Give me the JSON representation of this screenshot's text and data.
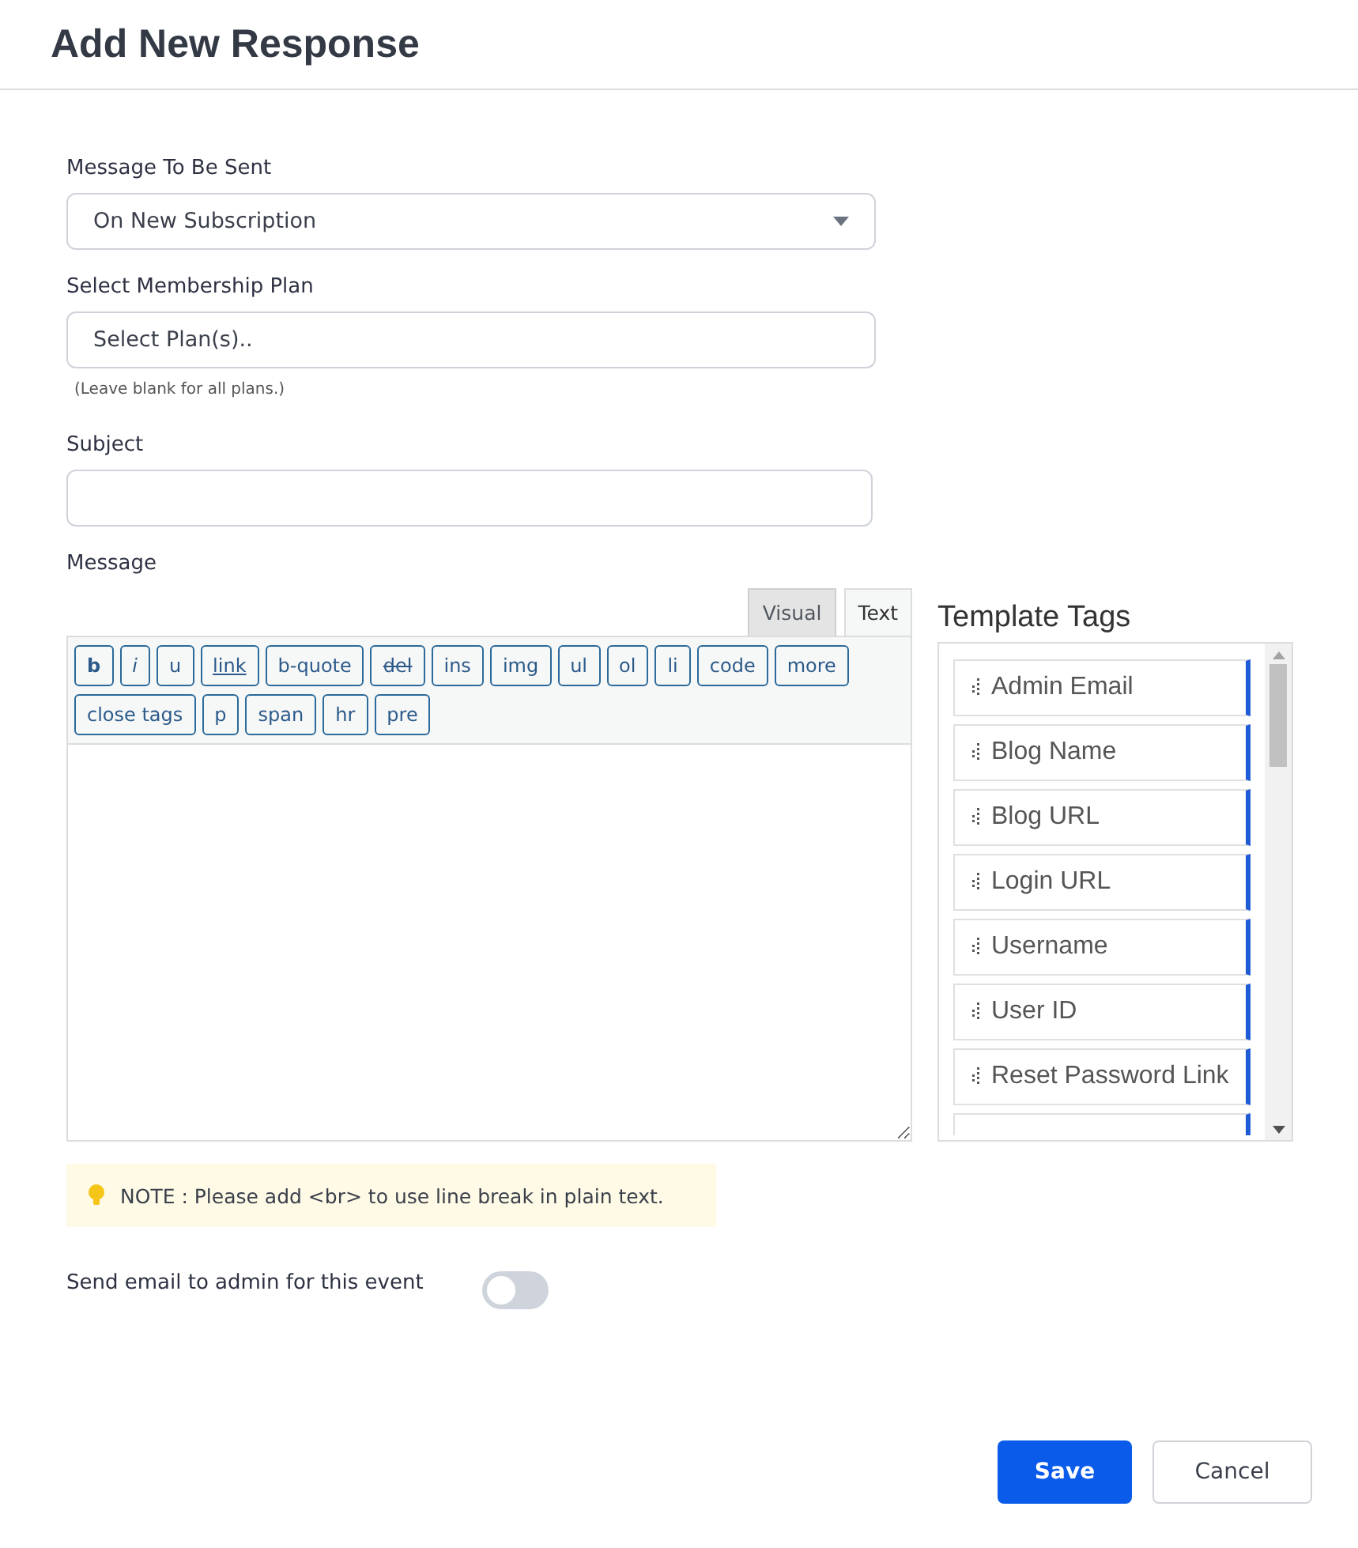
{
  "header": {
    "title": "Add New Response"
  },
  "message_to_be_sent": {
    "label": "Message To Be Sent",
    "value": "On New Subscription"
  },
  "membership_plan": {
    "label": "Select Membership Plan",
    "placeholder": "Select Plan(s)..",
    "hint": "(Leave blank for all plans.)"
  },
  "subject": {
    "label": "Subject"
  },
  "message": {
    "label": "Message",
    "tabs": [
      {
        "label": "Visual",
        "selected": false
      },
      {
        "label": "Text",
        "selected": true
      }
    ],
    "quicktags": [
      {
        "label": "b",
        "kind": "bold"
      },
      {
        "label": "i",
        "kind": "italic"
      },
      {
        "label": "u",
        "kind": "plain"
      },
      {
        "label": "link",
        "kind": "link"
      },
      {
        "label": "b-quote",
        "kind": "plain"
      },
      {
        "label": "del",
        "kind": "strike"
      },
      {
        "label": "ins",
        "kind": "plain"
      },
      {
        "label": "img",
        "kind": "plain"
      },
      {
        "label": "ul",
        "kind": "plain"
      },
      {
        "label": "ol",
        "kind": "plain"
      },
      {
        "label": "li",
        "kind": "plain"
      },
      {
        "label": "code",
        "kind": "plain"
      },
      {
        "label": "more",
        "kind": "plain"
      },
      {
        "label": "close tags",
        "kind": "plain"
      },
      {
        "label": "p",
        "kind": "plain"
      },
      {
        "label": "span",
        "kind": "plain"
      },
      {
        "label": "hr",
        "kind": "plain"
      },
      {
        "label": "pre",
        "kind": "plain"
      }
    ]
  },
  "template_tags": {
    "title": "Template Tags",
    "items": [
      "Admin Email",
      "Blog Name",
      "Blog URL",
      "Login URL",
      "Username",
      "User ID",
      "Reset Password Link"
    ]
  },
  "note": "NOTE : Please add <br> to use line break in plain text.",
  "admin_email": {
    "label": "Send email to admin for this event",
    "on": false
  },
  "buttons": [
    {
      "label": "Save",
      "kind": "primary"
    },
    {
      "label": "Cancel",
      "kind": "secondary"
    }
  ]
}
